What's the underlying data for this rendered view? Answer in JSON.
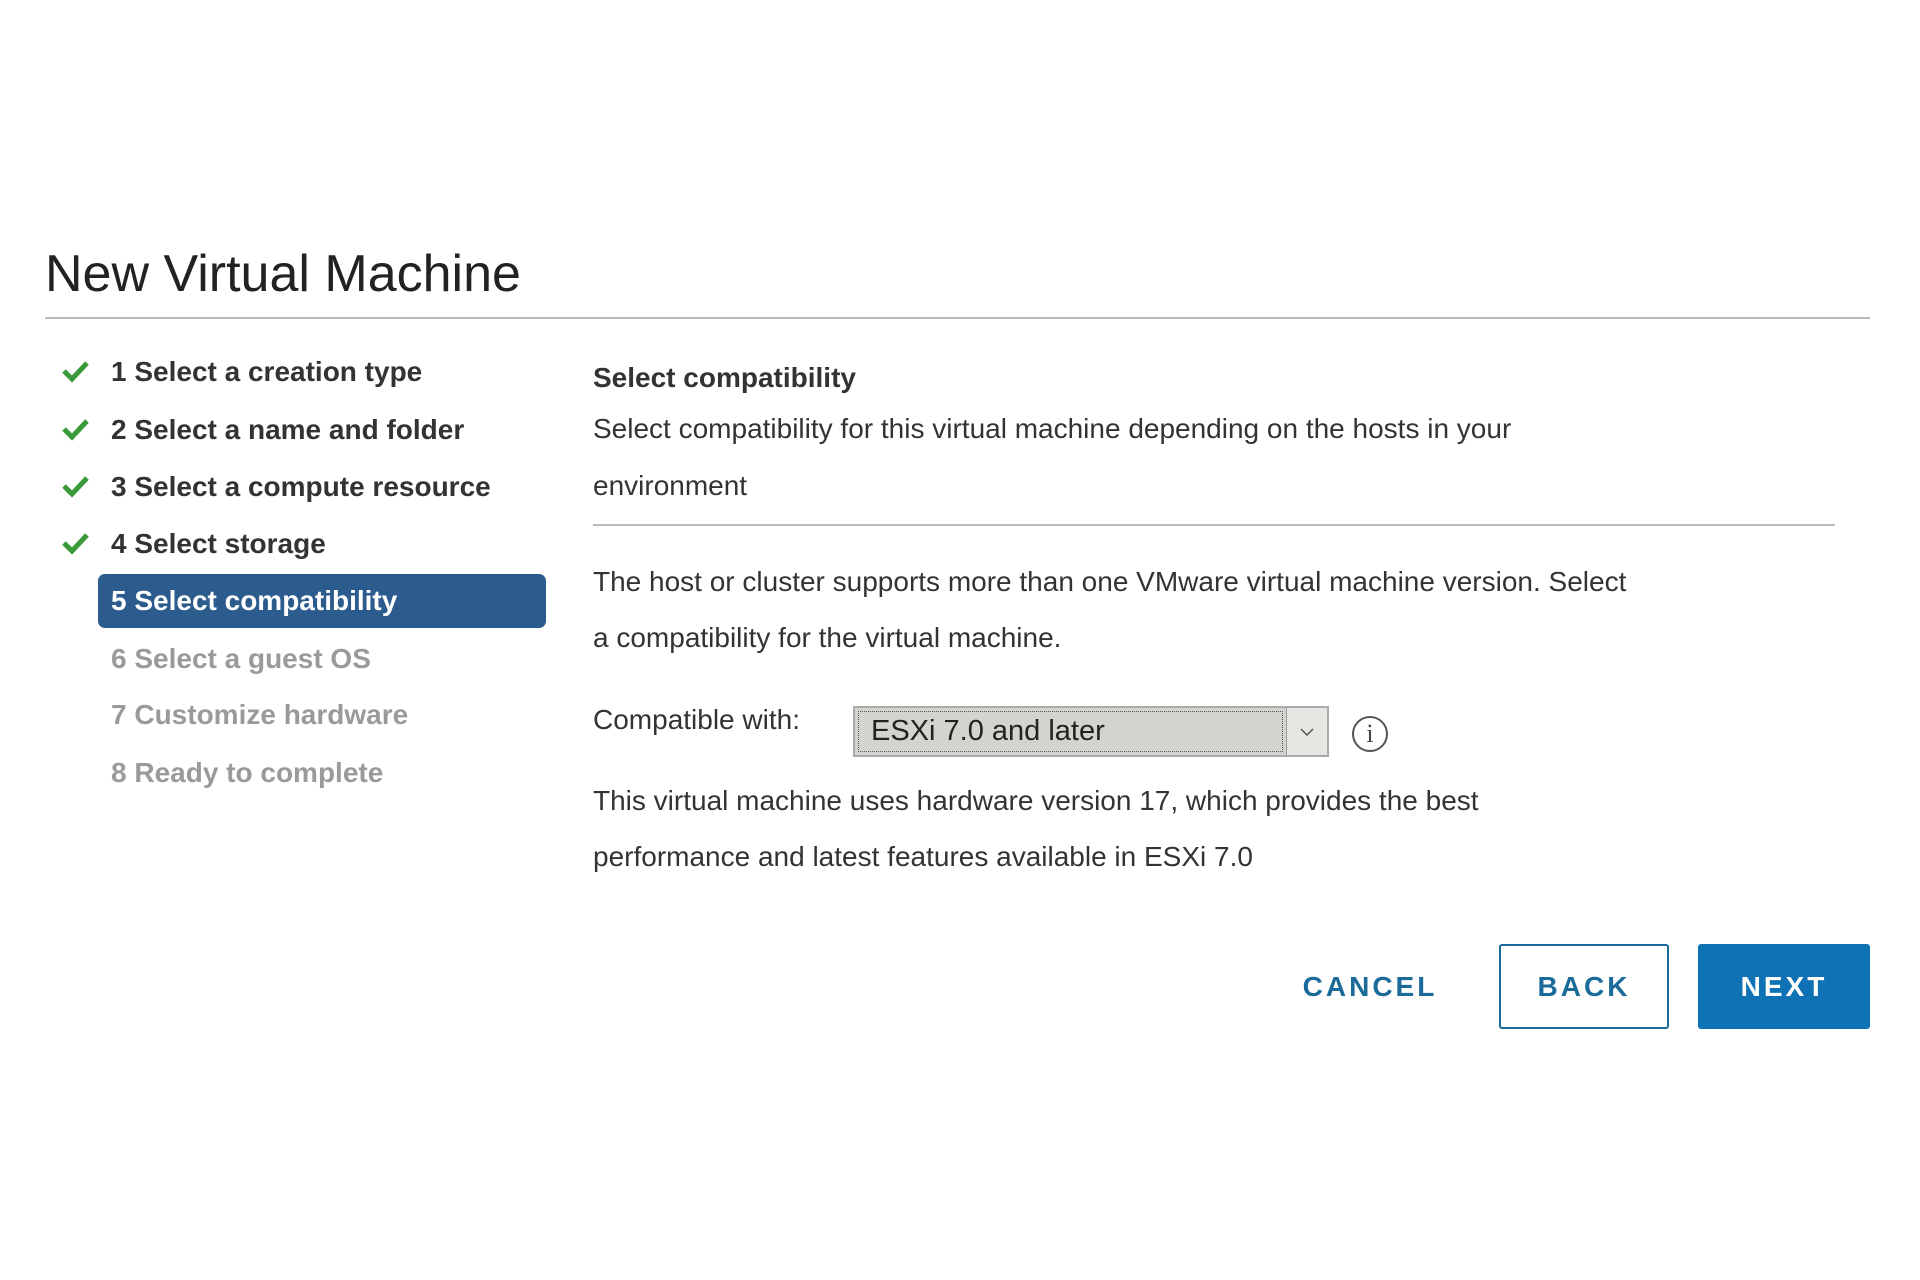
{
  "dialog": {
    "title": "New Virtual Machine"
  },
  "steps": [
    {
      "label": "1 Select a creation type",
      "status": "done"
    },
    {
      "label": "2 Select a name and folder",
      "status": "done"
    },
    {
      "label": "3 Select a compute resource",
      "status": "done"
    },
    {
      "label": "4 Select storage",
      "status": "done"
    },
    {
      "label": "5 Select compatibility",
      "status": "active"
    },
    {
      "label": "6 Select a guest OS",
      "status": "todo"
    },
    {
      "label": "7 Customize hardware",
      "status": "todo"
    },
    {
      "label": "8 Ready to complete",
      "status": "todo"
    }
  ],
  "content": {
    "heading": "Select compatibility",
    "description_line1": "Select compatibility for this virtual machine depending on the hosts in your",
    "description_line2": "environment",
    "info_line1": "The host or cluster supports more than one VMware virtual machine version. Select",
    "info_line2": "a compatibility for the virtual machine.",
    "compatible_label": "Compatible with:",
    "compatible_value": "ESXi 7.0 and later",
    "hw_line1": "This virtual machine uses hardware version 17, which provides the best",
    "hw_line2": "performance and latest features available in ESXi 7.0"
  },
  "buttons": {
    "cancel": "CANCEL",
    "back": "BACK",
    "next": "NEXT"
  },
  "colors": {
    "active_step": "#2c5b8e",
    "check": "#3a9a3a",
    "primary": "#0f72b5"
  }
}
